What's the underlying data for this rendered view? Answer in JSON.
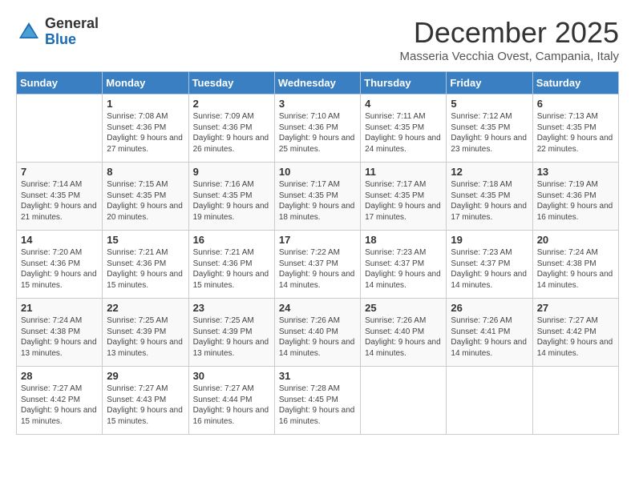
{
  "header": {
    "logo_general": "General",
    "logo_blue": "Blue",
    "month_title": "December 2025",
    "location": "Masseria Vecchia Ovest, Campania, Italy"
  },
  "weekdays": [
    "Sunday",
    "Monday",
    "Tuesday",
    "Wednesday",
    "Thursday",
    "Friday",
    "Saturday"
  ],
  "weeks": [
    [
      {
        "day": "",
        "sunrise": "",
        "sunset": "",
        "daylight": ""
      },
      {
        "day": "1",
        "sunrise": "Sunrise: 7:08 AM",
        "sunset": "Sunset: 4:36 PM",
        "daylight": "Daylight: 9 hours and 27 minutes."
      },
      {
        "day": "2",
        "sunrise": "Sunrise: 7:09 AM",
        "sunset": "Sunset: 4:36 PM",
        "daylight": "Daylight: 9 hours and 26 minutes."
      },
      {
        "day": "3",
        "sunrise": "Sunrise: 7:10 AM",
        "sunset": "Sunset: 4:36 PM",
        "daylight": "Daylight: 9 hours and 25 minutes."
      },
      {
        "day": "4",
        "sunrise": "Sunrise: 7:11 AM",
        "sunset": "Sunset: 4:35 PM",
        "daylight": "Daylight: 9 hours and 24 minutes."
      },
      {
        "day": "5",
        "sunrise": "Sunrise: 7:12 AM",
        "sunset": "Sunset: 4:35 PM",
        "daylight": "Daylight: 9 hours and 23 minutes."
      },
      {
        "day": "6",
        "sunrise": "Sunrise: 7:13 AM",
        "sunset": "Sunset: 4:35 PM",
        "daylight": "Daylight: 9 hours and 22 minutes."
      }
    ],
    [
      {
        "day": "7",
        "sunrise": "Sunrise: 7:14 AM",
        "sunset": "Sunset: 4:35 PM",
        "daylight": "Daylight: 9 hours and 21 minutes."
      },
      {
        "day": "8",
        "sunrise": "Sunrise: 7:15 AM",
        "sunset": "Sunset: 4:35 PM",
        "daylight": "Daylight: 9 hours and 20 minutes."
      },
      {
        "day": "9",
        "sunrise": "Sunrise: 7:16 AM",
        "sunset": "Sunset: 4:35 PM",
        "daylight": "Daylight: 9 hours and 19 minutes."
      },
      {
        "day": "10",
        "sunrise": "Sunrise: 7:17 AM",
        "sunset": "Sunset: 4:35 PM",
        "daylight": "Daylight: 9 hours and 18 minutes."
      },
      {
        "day": "11",
        "sunrise": "Sunrise: 7:17 AM",
        "sunset": "Sunset: 4:35 PM",
        "daylight": "Daylight: 9 hours and 17 minutes."
      },
      {
        "day": "12",
        "sunrise": "Sunrise: 7:18 AM",
        "sunset": "Sunset: 4:35 PM",
        "daylight": "Daylight: 9 hours and 17 minutes."
      },
      {
        "day": "13",
        "sunrise": "Sunrise: 7:19 AM",
        "sunset": "Sunset: 4:36 PM",
        "daylight": "Daylight: 9 hours and 16 minutes."
      }
    ],
    [
      {
        "day": "14",
        "sunrise": "Sunrise: 7:20 AM",
        "sunset": "Sunset: 4:36 PM",
        "daylight": "Daylight: 9 hours and 15 minutes."
      },
      {
        "day": "15",
        "sunrise": "Sunrise: 7:21 AM",
        "sunset": "Sunset: 4:36 PM",
        "daylight": "Daylight: 9 hours and 15 minutes."
      },
      {
        "day": "16",
        "sunrise": "Sunrise: 7:21 AM",
        "sunset": "Sunset: 4:36 PM",
        "daylight": "Daylight: 9 hours and 15 minutes."
      },
      {
        "day": "17",
        "sunrise": "Sunrise: 7:22 AM",
        "sunset": "Sunset: 4:37 PM",
        "daylight": "Daylight: 9 hours and 14 minutes."
      },
      {
        "day": "18",
        "sunrise": "Sunrise: 7:23 AM",
        "sunset": "Sunset: 4:37 PM",
        "daylight": "Daylight: 9 hours and 14 minutes."
      },
      {
        "day": "19",
        "sunrise": "Sunrise: 7:23 AM",
        "sunset": "Sunset: 4:37 PM",
        "daylight": "Daylight: 9 hours and 14 minutes."
      },
      {
        "day": "20",
        "sunrise": "Sunrise: 7:24 AM",
        "sunset": "Sunset: 4:38 PM",
        "daylight": "Daylight: 9 hours and 14 minutes."
      }
    ],
    [
      {
        "day": "21",
        "sunrise": "Sunrise: 7:24 AM",
        "sunset": "Sunset: 4:38 PM",
        "daylight": "Daylight: 9 hours and 13 minutes."
      },
      {
        "day": "22",
        "sunrise": "Sunrise: 7:25 AM",
        "sunset": "Sunset: 4:39 PM",
        "daylight": "Daylight: 9 hours and 13 minutes."
      },
      {
        "day": "23",
        "sunrise": "Sunrise: 7:25 AM",
        "sunset": "Sunset: 4:39 PM",
        "daylight": "Daylight: 9 hours and 13 minutes."
      },
      {
        "day": "24",
        "sunrise": "Sunrise: 7:26 AM",
        "sunset": "Sunset: 4:40 PM",
        "daylight": "Daylight: 9 hours and 14 minutes."
      },
      {
        "day": "25",
        "sunrise": "Sunrise: 7:26 AM",
        "sunset": "Sunset: 4:40 PM",
        "daylight": "Daylight: 9 hours and 14 minutes."
      },
      {
        "day": "26",
        "sunrise": "Sunrise: 7:26 AM",
        "sunset": "Sunset: 4:41 PM",
        "daylight": "Daylight: 9 hours and 14 minutes."
      },
      {
        "day": "27",
        "sunrise": "Sunrise: 7:27 AM",
        "sunset": "Sunset: 4:42 PM",
        "daylight": "Daylight: 9 hours and 14 minutes."
      }
    ],
    [
      {
        "day": "28",
        "sunrise": "Sunrise: 7:27 AM",
        "sunset": "Sunset: 4:42 PM",
        "daylight": "Daylight: 9 hours and 15 minutes."
      },
      {
        "day": "29",
        "sunrise": "Sunrise: 7:27 AM",
        "sunset": "Sunset: 4:43 PM",
        "daylight": "Daylight: 9 hours and 15 minutes."
      },
      {
        "day": "30",
        "sunrise": "Sunrise: 7:27 AM",
        "sunset": "Sunset: 4:44 PM",
        "daylight": "Daylight: 9 hours and 16 minutes."
      },
      {
        "day": "31",
        "sunrise": "Sunrise: 7:28 AM",
        "sunset": "Sunset: 4:45 PM",
        "daylight": "Daylight: 9 hours and 16 minutes."
      },
      {
        "day": "",
        "sunrise": "",
        "sunset": "",
        "daylight": ""
      },
      {
        "day": "",
        "sunrise": "",
        "sunset": "",
        "daylight": ""
      },
      {
        "day": "",
        "sunrise": "",
        "sunset": "",
        "daylight": ""
      }
    ]
  ]
}
